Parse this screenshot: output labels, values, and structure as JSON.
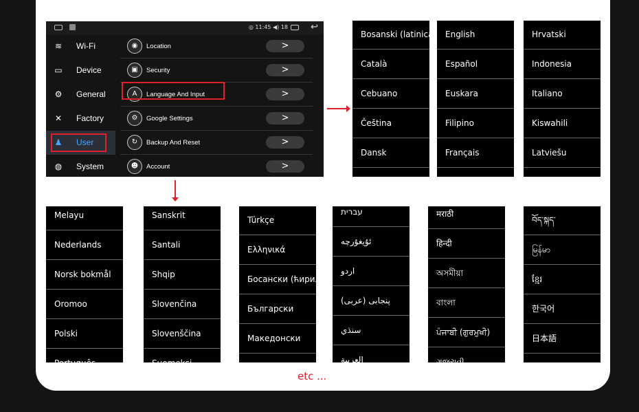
{
  "status_bar": {
    "time": "11:45",
    "signal": "18"
  },
  "sidebar": {
    "items": [
      {
        "label": "Wi-Fi",
        "icon": "wifi-icon"
      },
      {
        "label": "Device",
        "icon": "display-icon"
      },
      {
        "label": "General",
        "icon": "gear-icon"
      },
      {
        "label": "Factory",
        "icon": "tools-icon"
      },
      {
        "label": "User",
        "icon": "user-icon",
        "active": true
      },
      {
        "label": "System",
        "icon": "globe-icon"
      }
    ]
  },
  "settings": {
    "rows": [
      {
        "label": "Location",
        "icon": "location-icon"
      },
      {
        "label": "Security",
        "icon": "lock-icon"
      },
      {
        "label": "Language And Input",
        "icon": "language-icon",
        "highlighted": true
      },
      {
        "label": "Google Settings",
        "icon": "google-icon"
      },
      {
        "label": "Backup And Reset",
        "icon": "backup-icon"
      },
      {
        "label": "Account",
        "icon": "account-icon"
      }
    ],
    "chevron": ">"
  },
  "language_panels": [
    [
      "Bosanski (latinica)",
      "Català",
      "Cebuano",
      "Čeština",
      "Dansk"
    ],
    [
      "English",
      "Español",
      "Euskara",
      "Filipino",
      "Français"
    ],
    [
      "Hrvatski",
      "Indonesia",
      "Italiano",
      "Kiswahili",
      "Latviešu"
    ],
    [
      "Melayu",
      "Nederlands",
      "Norsk bokmål",
      "Oromoo",
      "Polski",
      "Português"
    ],
    [
      "Sanskrit",
      "Santali",
      "Shqip",
      "Slovenčina",
      "Slovenščina",
      "Suomeksi"
    ],
    [
      "Türkçe",
      "Ελληνικά",
      "Босански (ћирилица)",
      "Български",
      "Македонски"
    ],
    [
      "עברית",
      "ئۇيغۇرچە",
      "اردو",
      "پنجابی (عربی)",
      "سنڌي",
      "العربية"
    ],
    [
      "मराठी",
      "हिन्दी",
      "অসমীয়া",
      "বাংলা",
      "ਪੰਜਾਬੀ (ਗੁਰਮੁਖੀ)",
      "ગુજરાતી"
    ],
    [
      "བོད་སྐད་",
      "မြန်မာ",
      "ខ្មែរ",
      "한국어",
      "日本語"
    ]
  ],
  "footer_text": "etc ...",
  "colors": {
    "accent": "#e0202a",
    "active": "#4ba3ff"
  }
}
